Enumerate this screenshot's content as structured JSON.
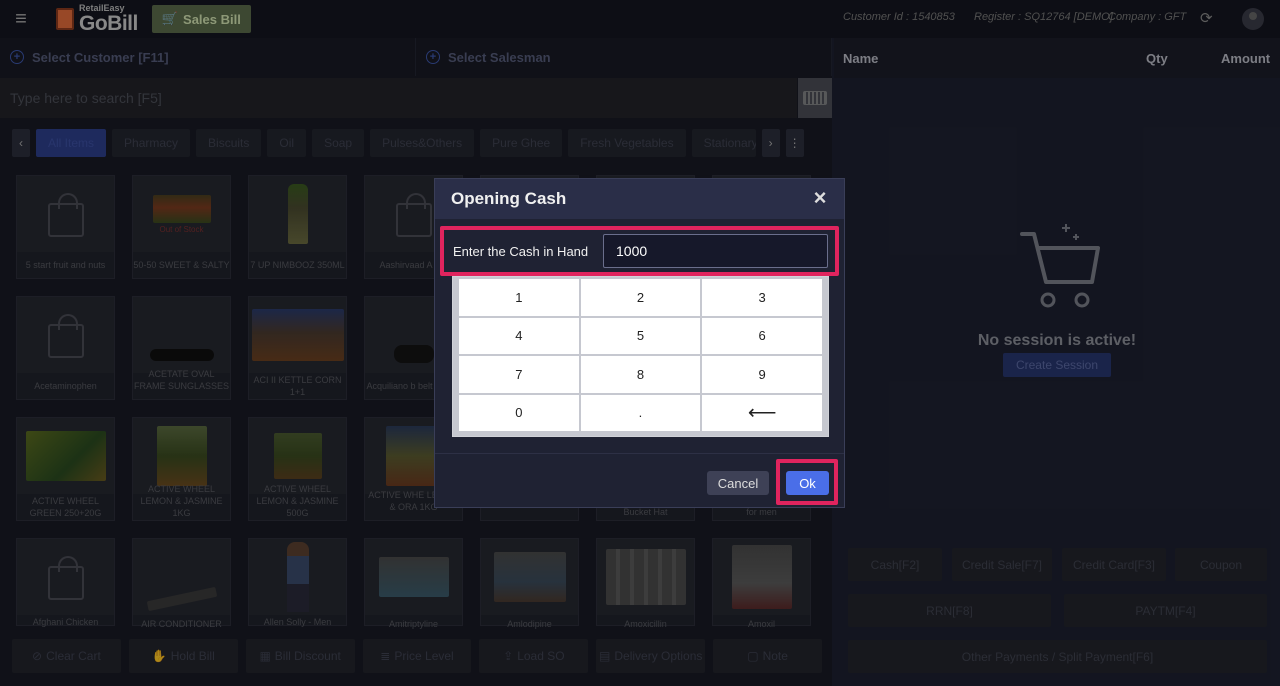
{
  "app": {
    "brand_top": "RetailEasy",
    "brand_name": "GoBill",
    "mode_button": "Sales Bill",
    "customer_id": "Customer Id : 1540853",
    "register": "Register : SQ12764 [DEMO]",
    "company": "Company : GFT"
  },
  "selectors": {
    "customer": "Select Customer [F11]",
    "salesman": "Select Salesman"
  },
  "search": {
    "placeholder": "Type here to search [F5]"
  },
  "categories": [
    "All Items",
    "Pharmacy",
    "Biscuits",
    "Oil",
    "Soap",
    "Pulses&Others",
    "Pure Ghee",
    "Fresh Vegetables",
    "Stationary"
  ],
  "products": [
    {
      "label": "5 start fruit and nuts",
      "badge": ""
    },
    {
      "label": "50-50 SWEET & SALTY",
      "badge": "Out of Stock"
    },
    {
      "label": "7 UP NIMBOOZ 350ML",
      "badge": ""
    },
    {
      "label": "Aashirvaad A KG",
      "badge": ""
    },
    {
      "label": "Acetaminophen",
      "badge": ""
    },
    {
      "label": "ACETATE OVAL FRAME SUNGLASSES",
      "badge": ""
    },
    {
      "label": "ACI II KETTLE CORN 1+1",
      "badge": ""
    },
    {
      "label": "Acquiliano b belt for me",
      "badge": ""
    },
    {
      "label": "ACTIVE WHEEL GREEN 250+20G",
      "badge": ""
    },
    {
      "label": "ACTIVE WHEEL LEMON & JASMINE 1KG",
      "badge": ""
    },
    {
      "label": "ACTIVE WHEEL LEMON & JASMINE 500G",
      "badge": ""
    },
    {
      "label": "ACTIVE WHE LEMON & ORA 1KG",
      "badge": ""
    },
    {
      "label": "Bucket Hat",
      "badge": ""
    },
    {
      "label": "for men",
      "badge": ""
    },
    {
      "label": "Afghani Chicken",
      "badge": ""
    },
    {
      "label": "AIR CONDITIONER",
      "badge": ""
    },
    {
      "label": "Allen Solly - Men",
      "badge": ""
    },
    {
      "label": "Amitriptyline",
      "badge": ""
    },
    {
      "label": "Amlodipine",
      "badge": ""
    },
    {
      "label": "Amoxicillin",
      "badge": ""
    },
    {
      "label": "Amoxil",
      "badge": ""
    }
  ],
  "bottom_actions": [
    "Clear Cart",
    "Hold Bill",
    "Bill Discount",
    "Price Level",
    "Load SO",
    "Delivery Options",
    "Note"
  ],
  "cart": {
    "col_name": "Name",
    "col_qty": "Qty",
    "col_amount": "Amount",
    "empty_message": "No session is active!",
    "create_session": "Create Session"
  },
  "payments": {
    "cash": "Cash[F2]",
    "credit_sale": "Credit Sale[F7]",
    "credit_card": "Credit Card[F3]",
    "coupon": "Coupon",
    "rrn": "RRN[F8]",
    "paytm": "PAYTM[F4]",
    "other": "Other Payments / Split Payment[F6]"
  },
  "modal": {
    "title": "Opening Cash",
    "cash_label": "Enter the Cash in Hand",
    "cash_value": "1000",
    "keys": [
      "1",
      "2",
      "3",
      "4",
      "5",
      "6",
      "7",
      "8",
      "9",
      "0",
      ".",
      "⟵"
    ],
    "cancel": "Cancel",
    "ok": "Ok"
  },
  "colors": {
    "highlight": "#e0245e",
    "primary": "#4a6ee8"
  }
}
